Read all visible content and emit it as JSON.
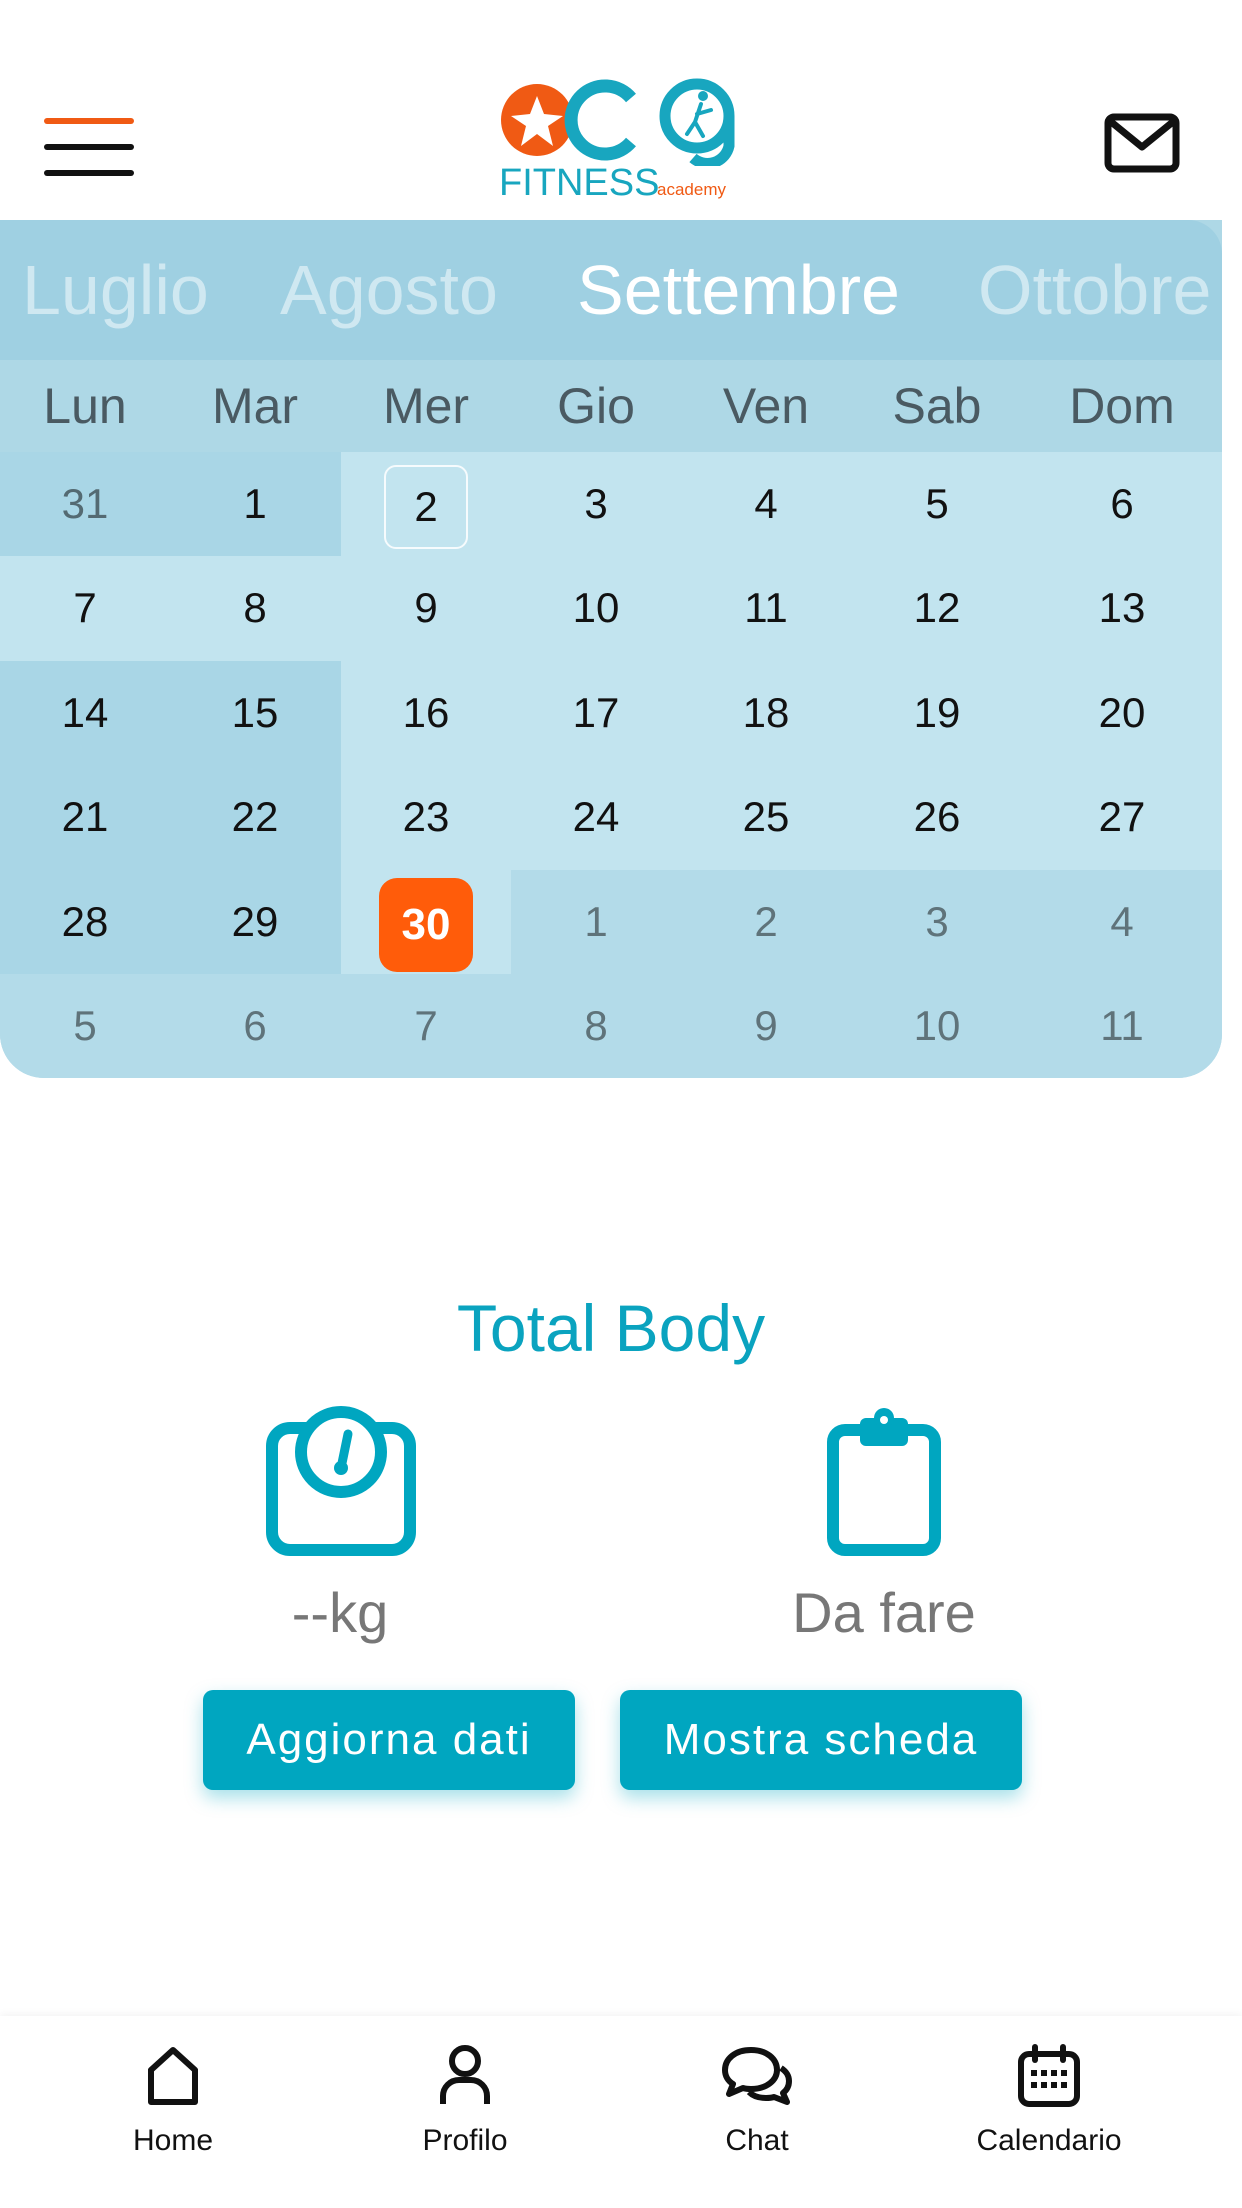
{
  "header": {
    "logo_main": "FITNESS",
    "logo_sub": "academy",
    "colors": {
      "brand_orange": "#f05a14",
      "brand_teal": "#18a6bf"
    }
  },
  "calendar": {
    "months": [
      "Luglio",
      "Agosto",
      "Settembre",
      "Ottobre"
    ],
    "active_month": "Settembre",
    "weekdays": [
      "Lun",
      "Mar",
      "Mer",
      "Gio",
      "Ven",
      "Sab",
      "Dom"
    ],
    "weeks": [
      [
        "31",
        "1",
        "2",
        "3",
        "4",
        "5",
        "6"
      ],
      [
        "7",
        "8",
        "9",
        "10",
        "11",
        "12",
        "13"
      ],
      [
        "14",
        "15",
        "16",
        "17",
        "18",
        "19",
        "20"
      ],
      [
        "21",
        "22",
        "23",
        "24",
        "25",
        "26",
        "27"
      ],
      [
        "28",
        "29",
        "30",
        "1",
        "2",
        "3",
        "4"
      ],
      [
        "5",
        "6",
        "7",
        "8",
        "9",
        "10",
        "11"
      ]
    ],
    "today": "30",
    "selected": "2",
    "colors": {
      "today": "#ff5c0a",
      "background": "#aed8e6"
    }
  },
  "workout": {
    "title": "Total Body",
    "weight_value": "--kg",
    "status": "Da fare",
    "update_button": "Aggiorna dati",
    "show_button": "Mostra scheda",
    "accent": "#00a6c0"
  },
  "nav": {
    "items": [
      {
        "label": "Home",
        "icon": "home-icon"
      },
      {
        "label": "Profilo",
        "icon": "user-icon"
      },
      {
        "label": "Chat",
        "icon": "chat-icon"
      },
      {
        "label": "Calendario",
        "icon": "calendar-icon"
      }
    ]
  }
}
